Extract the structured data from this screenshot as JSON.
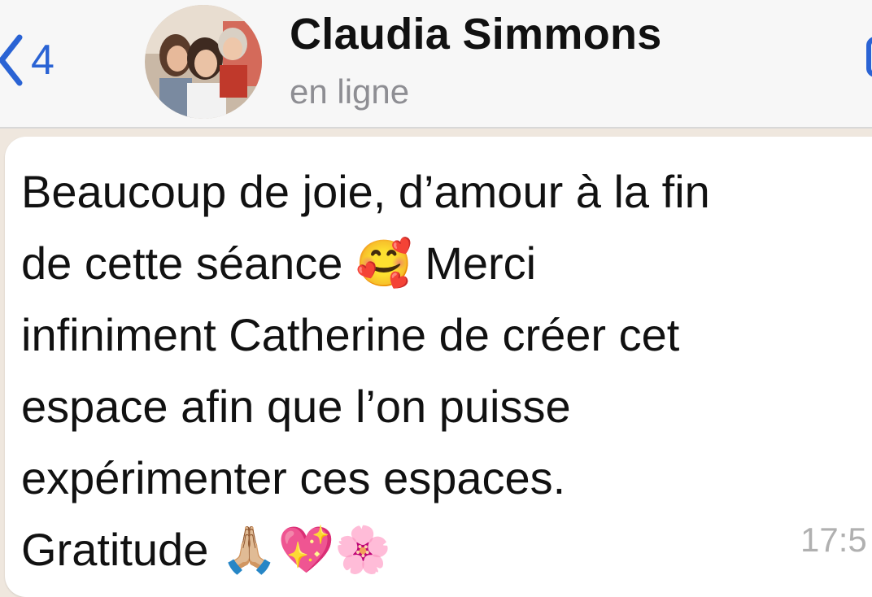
{
  "header": {
    "back_count": "4",
    "back_icon": "chevron-left-icon",
    "contact_name": "Claudia Simmons",
    "status": "en ligne",
    "call_icon": "phone-icon"
  },
  "message": {
    "lines": [
      "Beaucoup de joie, d’amour à la fin",
      "de cette séance 🥰 Merci",
      "infiniment Catherine de créer cet",
      "espace afin que l’on puisse",
      "expérimenter ces espaces.",
      "Gratitude 🙏🏼💖🌸"
    ],
    "time": "17:5"
  },
  "colors": {
    "accent": "#2a63d4",
    "header_bg": "#f7f7f7",
    "chat_bg": "#efe7de",
    "bubble_bg": "#ffffff",
    "status_text": "#8e8e93"
  }
}
